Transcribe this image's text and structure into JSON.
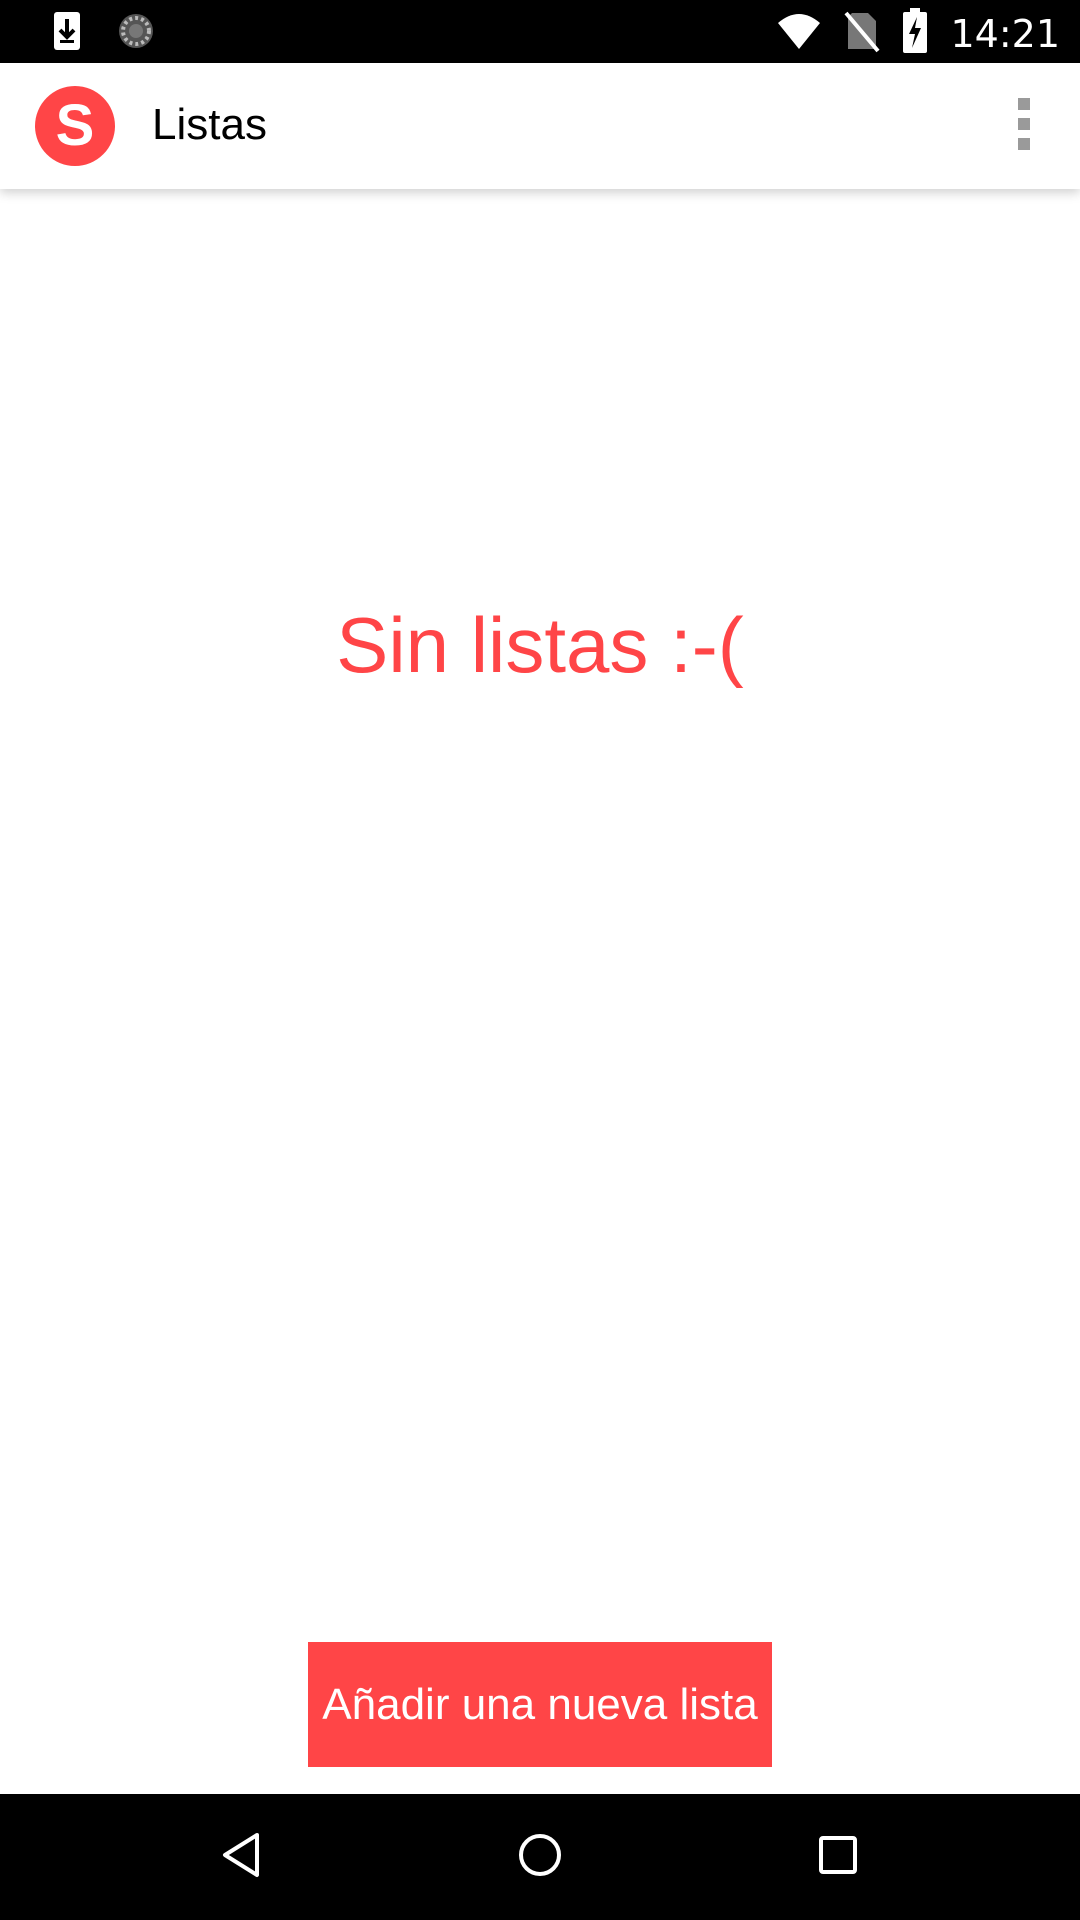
{
  "status_bar": {
    "time": "14:21",
    "icons": [
      "download-icon",
      "sync-icon",
      "wifi-icon",
      "no-sim-icon",
      "battery-charging-icon"
    ]
  },
  "app_bar": {
    "logo_letter": "S",
    "title": "Listas",
    "overflow_icon": "more-vert-icon"
  },
  "main": {
    "empty_message": "Sin listas :-(",
    "add_button_label": "Añadir una nueva lista"
  },
  "nav_bar": {
    "icons": [
      "back-icon",
      "home-icon",
      "recents-icon"
    ]
  },
  "colors": {
    "accent": "#ff4547",
    "status_bar": "#000000",
    "nav_bar": "#000000",
    "background": "#ffffff"
  }
}
